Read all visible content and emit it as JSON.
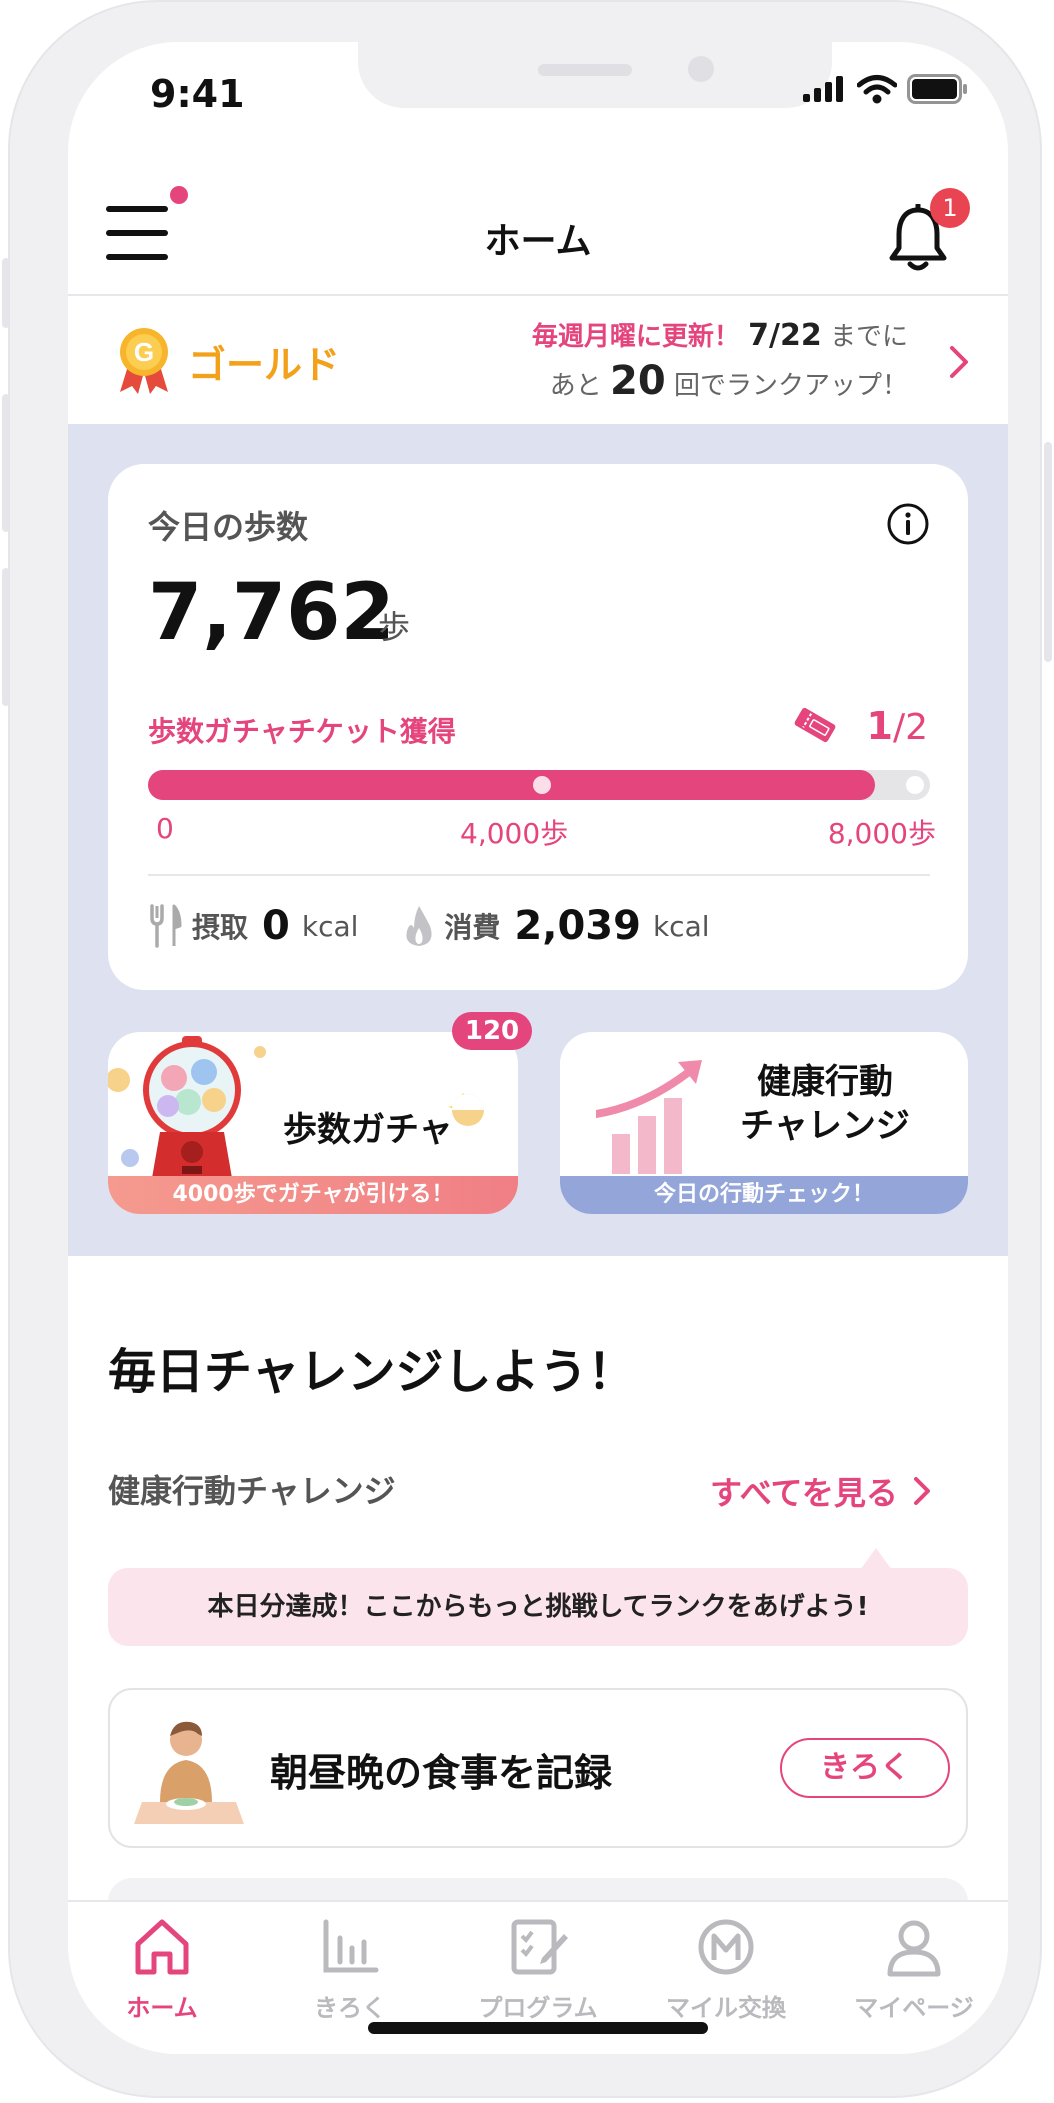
{
  "status": {
    "time": "9:41"
  },
  "header": {
    "title": "ホーム",
    "notification_count": "1"
  },
  "rank": {
    "name": "ゴールド",
    "line1_prefix": "毎週月曜に更新！",
    "line1_date": "7/22",
    "line1_suffix": "までに",
    "line2_prefix": "あと",
    "line2_count": "20",
    "line2_suffix": "回でランクアップ！"
  },
  "steps": {
    "label": "今日の歩数",
    "value": "7,762",
    "unit": "歩",
    "ticket_label": "歩数ガチャチケット獲得",
    "ticket_current": "1",
    "ticket_total": "/2",
    "progress": 0.93,
    "scale_min": "0",
    "scale_mid": "4,000歩",
    "scale_max": "8,000歩",
    "intake_label": "摂取",
    "intake_value": "0",
    "intake_unit": "kcal",
    "burn_label": "消費",
    "burn_value": "2,039",
    "burn_unit": "kcal"
  },
  "gacha": {
    "title": "歩数ガチャ",
    "badge": "120",
    "caption": "4000歩でガチャが引ける！"
  },
  "challenge_card": {
    "title_line1": "健康行動",
    "title_line2": "チャレンジ",
    "caption": "今日の行動チェック！"
  },
  "daily": {
    "title": "毎日チャレンジしよう！",
    "subtitle": "健康行動チャレンジ",
    "see_all": "すべてを見る",
    "tip": "本日分達成！ここからもっと挑戦してランクをあげよう!",
    "task_title": "朝昼晩の食事を記録",
    "task_button": "きろく"
  },
  "tabs": [
    {
      "label": "ホーム",
      "icon": "home-icon"
    },
    {
      "label": "きろく",
      "icon": "chart-icon"
    },
    {
      "label": "プログラム",
      "icon": "program-icon"
    },
    {
      "label": "マイル交換",
      "icon": "mile-icon"
    },
    {
      "label": "マイページ",
      "icon": "user-icon"
    }
  ],
  "colors": {
    "accent": "#e5457d",
    "gold": "#f3a11a",
    "lavender": "#dee2f0",
    "challenge_blue": "#93a5d9"
  }
}
